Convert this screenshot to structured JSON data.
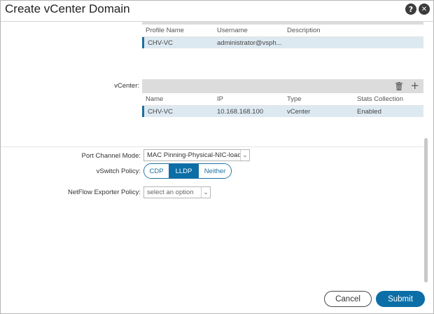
{
  "dialog": {
    "title": "Create vCenter Domain",
    "help_icon": "help-icon",
    "close_icon": "close-icon",
    "help_glyph": "?",
    "close_glyph": "✕"
  },
  "credentials": {
    "columns": [
      "Profile Name",
      "Username",
      "Description"
    ],
    "rows": [
      {
        "profile_name": "CHV-VC",
        "username": "administrator@vsph...",
        "description": ""
      }
    ]
  },
  "vcenter": {
    "label": "vCenter:",
    "delete_icon": "trash-icon",
    "add_icon": "plus-icon",
    "add_glyph": "+",
    "columns": [
      "Name",
      "IP",
      "Type",
      "Stats Collection"
    ],
    "rows": [
      {
        "name": "CHV-VC",
        "ip": "10.168.168.100",
        "type": "vCenter",
        "stats": "Enabled"
      }
    ]
  },
  "port_channel": {
    "label": "Port Channel Mode:",
    "value": "MAC Pinning-Physical-NIC-load",
    "chevron": "⌄"
  },
  "vswitch": {
    "label": "vSwitch Policy:",
    "options": [
      "CDP",
      "LLDP",
      "Neither"
    ],
    "selected": "LLDP"
  },
  "netflow": {
    "label": "NetFlow Exporter Policy:",
    "placeholder": "select an option",
    "chevron": "⌄"
  },
  "footer": {
    "cancel_label": "Cancel",
    "submit_label": "Submit"
  },
  "colors": {
    "accent": "#0b6ea6",
    "selected_row": "#dde9f1",
    "header_bar": "#dcdcdc"
  }
}
